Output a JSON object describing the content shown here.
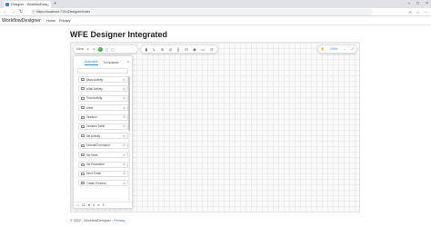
{
  "browser": {
    "tab_title": "Designer - WorkflowDesigner",
    "tab_close": "×",
    "new_tab": "+",
    "window_controls": [
      "–",
      "□",
      "×"
    ],
    "nav": {
      "back": "←",
      "forward": "→",
      "reload": "↻"
    },
    "lock": "ⓘ",
    "url": "https://localhost:7191/Designer/Index",
    "addr_icons": [
      "A",
      "☆",
      "⋯"
    ]
  },
  "site": {
    "brand": "WorkflowDesigner",
    "nav": [
      "Home",
      "Privacy"
    ]
  },
  "page": {
    "title": "WFE Designer Integrated"
  },
  "toolbar": {
    "menu_label": "Menu",
    "undo": "↶",
    "redo": "↷",
    "toggle": "✓",
    "icons": [
      "◻",
      "◻"
    ]
  },
  "icon_tools": [
    "▮",
    "↳",
    "⊘",
    "◎",
    "{}",
    "⊟",
    "◉",
    "▭",
    "⊙"
  ],
  "zoom": {
    "hand": "✋",
    "value": "100%",
    "fit": "↔",
    "expand": "⤢"
  },
  "panel": {
    "tabs": [
      "Activities",
      "Templates"
    ],
    "close": "×",
    "activities": [
      "Basic Activity",
      "Initial Activity",
      "Final Activity",
      "Inline",
      "Decision",
      "Decision Table",
      "Set Activity",
      "ExecuteCommand",
      "Set State",
      "Set Parameter",
      "Send Email",
      "Create Process"
    ],
    "gear": "⚙",
    "footer": [
      "12",
      "0",
      "0"
    ]
  },
  "footer": {
    "text": "© 2022 - WorkflowDesigner - ",
    "privacy_link": "Privacy"
  }
}
